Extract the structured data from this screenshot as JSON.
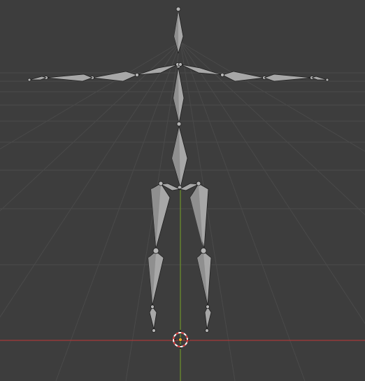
{
  "viewport": {
    "background": "#3d3d3d",
    "grid_color": "#4a4a4a",
    "x_axis_color": "#a63a3a",
    "y_axis_color": "#6a8d2c"
  },
  "armature": {
    "bone_color": "#a7a7a7",
    "outline_color": "#1e1e1e",
    "bone_count": 17
  },
  "cursor": {
    "icon": "3d-cursor-icon",
    "ring_colors": [
      "#ffffff",
      "#d93a3a"
    ],
    "center_color": "#f2a32a"
  }
}
